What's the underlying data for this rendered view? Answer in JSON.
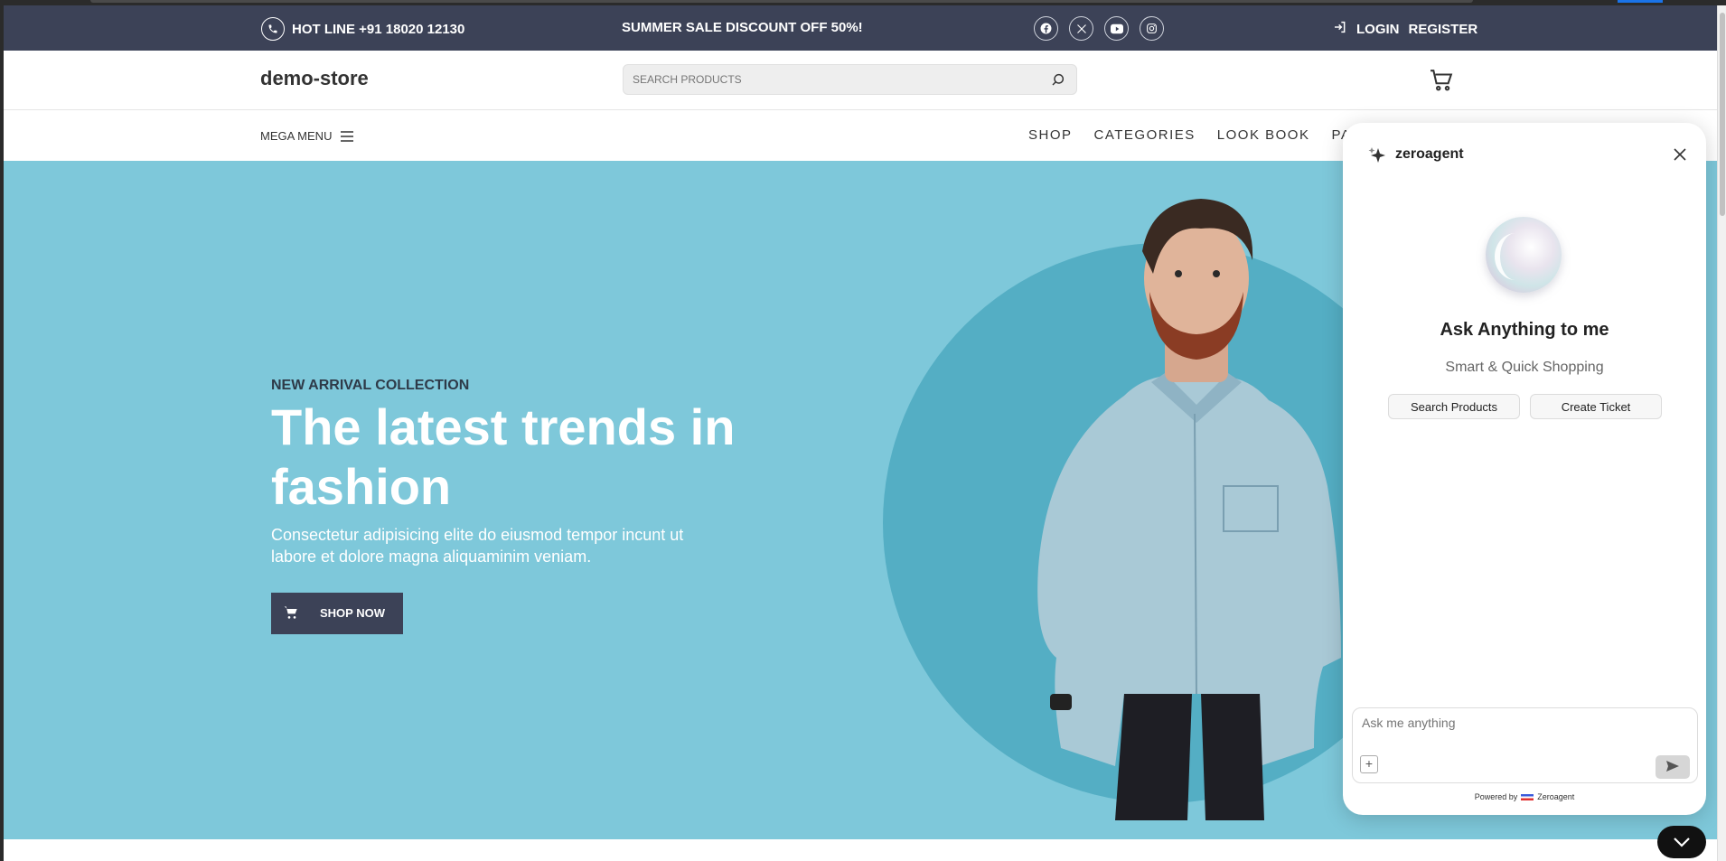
{
  "topbar": {
    "hotline": "HOT LINE +91 18020 12130",
    "sale": "SUMMER SALE DISCOUNT OFF 50%!",
    "socials": [
      "facebook-icon",
      "x-icon",
      "youtube-icon",
      "instagram-icon"
    ],
    "login": "LOGIN",
    "register": "REGISTER"
  },
  "header": {
    "logo": "demo-store",
    "search_placeholder": "SEARCH PRODUCTS"
  },
  "nav": {
    "mega_menu": "MEGA MENU",
    "links": [
      "SHOP",
      "CATEGORIES",
      "LOOK BOOK",
      "PAGI"
    ]
  },
  "hero": {
    "eyebrow": "NEW ARRIVAL COLLECTION",
    "headline": "The latest trends in fashion",
    "description": "Consectetur adipisicing elite do eiusmod tempor incunt ut labore et dolore magna aliquaminim veniam.",
    "cta": "SHOP NOW"
  },
  "chat": {
    "brand": "zeroagent",
    "title": "Ask Anything to me",
    "subtitle": "Smart & Quick Shopping",
    "chips": [
      "Search Products",
      "Create Ticket"
    ],
    "input_placeholder": "Ask me anything",
    "powered_by": "Powered by",
    "powered_brand": "Zeroagent"
  },
  "colors": {
    "topbar_bg": "#3c4257",
    "hero_bg": "#7ec8da",
    "hero_circle": "#54aec4"
  }
}
